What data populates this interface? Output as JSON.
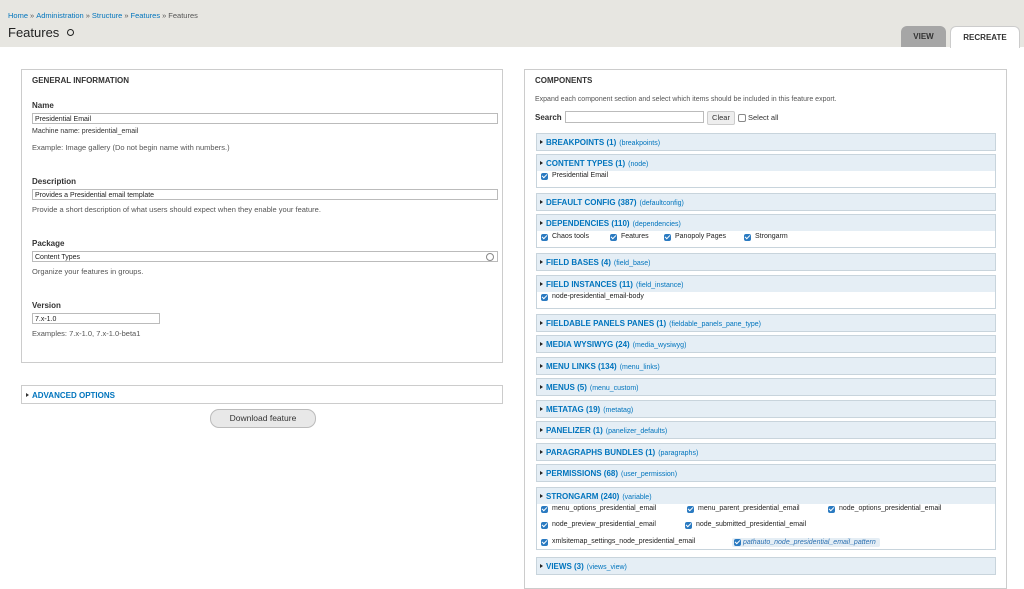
{
  "breadcrumb": {
    "home": "Home",
    "administration": "Administration",
    "structure": "Structure",
    "features_link": "Features",
    "current": "Features"
  },
  "page": {
    "title": "Features"
  },
  "tabs": {
    "view": "VIEW",
    "recreate": "RECREATE"
  },
  "general": {
    "title": "GENERAL INFORMATION",
    "name_label": "Name",
    "name_value": "Presidential Email",
    "machine_name": "Machine name: presidential_email",
    "name_help": "Example: Image gallery (Do not begin name with numbers.)",
    "description_label": "Description",
    "description_value": "Provides a Presidential email template",
    "description_help": "Provide a short description of what users should expect when they enable your feature.",
    "package_label": "Package",
    "package_value": "Content Types",
    "package_help": "Organize your features in groups.",
    "version_label": "Version",
    "version_value": "7.x-1.0",
    "version_help": "Examples: 7.x-1.0, 7.x-1.0-beta1"
  },
  "advanced": {
    "label": "ADVANCED OPTIONS"
  },
  "download_button": "Download feature",
  "components": {
    "title": "COMPONENTS",
    "help": "Expand each component section and select which items should be included in this feature export.",
    "search_label": "Search",
    "clear_button": "Clear",
    "select_all": "Select all",
    "sections": [
      {
        "name": "BREAKPOINTS (1)",
        "machine": "(breakpoints)"
      },
      {
        "name": "CONTENT TYPES (1)",
        "machine": "(node)",
        "items": [
          "Presidential Email"
        ]
      },
      {
        "name": "DEFAULT CONFIG (387)",
        "machine": "(defaultconfig)"
      },
      {
        "name": "DEPENDENCIES (110)",
        "machine": "(dependencies)",
        "items": [
          "Chaos tools",
          "Features",
          "Panopoly Pages",
          "Strongarm"
        ]
      },
      {
        "name": "FIELD BASES (4)",
        "machine": "(field_base)"
      },
      {
        "name": "FIELD INSTANCES (11)",
        "machine": "(field_instance)",
        "items": [
          "node-presidential_email-body"
        ]
      },
      {
        "name": "FIELDABLE PANELS PANES (1)",
        "machine": "(fieldable_panels_pane_type)"
      },
      {
        "name": "MEDIA WYSIWYG (24)",
        "machine": "(media_wysiwyg)"
      },
      {
        "name": "MENU LINKS (134)",
        "machine": "(menu_links)"
      },
      {
        "name": "MENUS (5)",
        "machine": "(menu_custom)"
      },
      {
        "name": "METATAG (19)",
        "machine": "(metatag)"
      },
      {
        "name": "PANELIZER (1)",
        "machine": "(panelizer_defaults)"
      },
      {
        "name": "PARAGRAPHS BUNDLES (1)",
        "machine": "(paragraphs)"
      },
      {
        "name": "PERMISSIONS (68)",
        "machine": "(user_permission)"
      },
      {
        "name": "STRONGARM (240)",
        "machine": "(variable)",
        "items": [
          "menu_options_presidential_email",
          "menu_parent_presidential_email",
          "node_options_presidential_email",
          "node_preview_presidential_email",
          "node_submitted_presidential_email",
          "xmlsitemap_settings_node_presidential_email",
          "pathauto_node_presidential_email_pattern"
        ]
      },
      {
        "name": "VIEWS (3)",
        "machine": "(views_view)"
      }
    ]
  }
}
